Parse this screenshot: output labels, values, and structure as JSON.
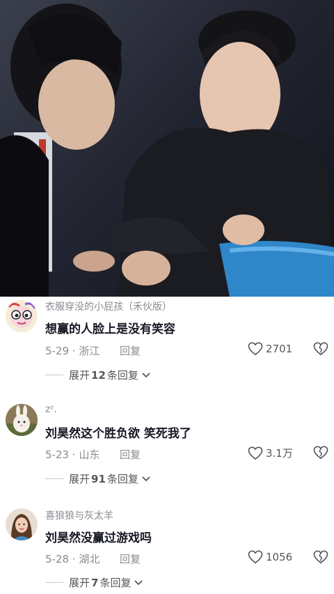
{
  "video": {
    "description_icon": "video-frame"
  },
  "comments": [
    {
      "nickname": "衣服穿没的小屁孩（禾伙版）",
      "text": "想赢的人脸上是没有笑容",
      "date_location": "5-29 · 浙江",
      "reply_label": "回复",
      "likes": "2701",
      "expand_prefix": "展开",
      "expand_count": "12",
      "expand_suffix": "条回复"
    },
    {
      "nickname": "zᶻ.",
      "text": "刘昊然这个胜负欲 笑死我了",
      "date_location": "5-23 · 山东",
      "reply_label": "回复",
      "likes": "3.1万",
      "expand_prefix": "展开",
      "expand_count": "91",
      "expand_suffix": "条回复"
    },
    {
      "nickname": "喜狼狼与灰太羊",
      "text": "刘昊然没赢过游戏吗",
      "date_location": "5-28 · 湖北",
      "reply_label": "回复",
      "likes": "1056",
      "expand_prefix": "展开",
      "expand_count": "7",
      "expand_suffix": "条回复"
    }
  ]
}
